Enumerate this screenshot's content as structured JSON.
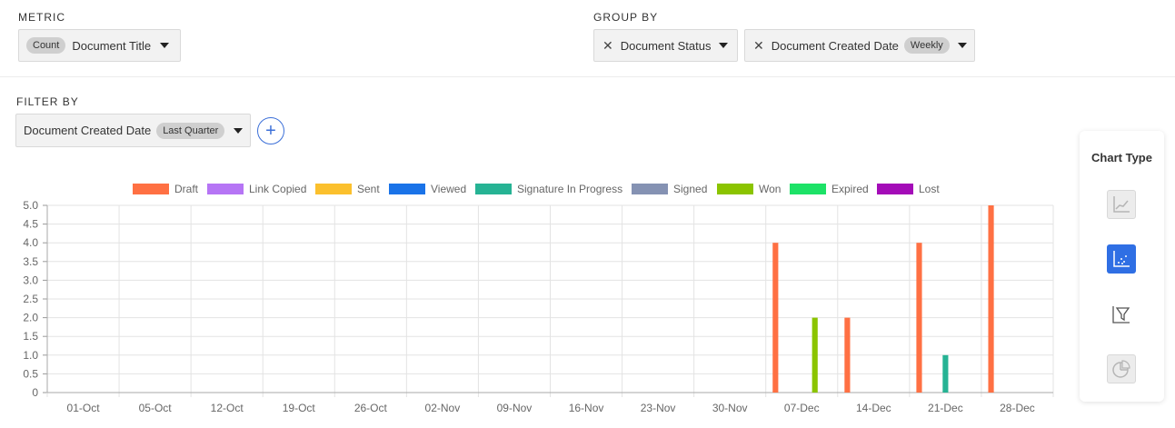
{
  "metric": {
    "label": "METRIC",
    "aggregation": "Count",
    "field": "Document Title"
  },
  "group_by": {
    "label": "GROUP BY",
    "fields": [
      {
        "name": "Document Status"
      },
      {
        "name": "Document Created Date",
        "interval": "Weekly"
      }
    ]
  },
  "filter_by": {
    "label": "FILTER BY",
    "field": "Document Created Date",
    "value": "Last Quarter"
  },
  "chart_type_panel": {
    "title": "Chart Type",
    "options": [
      "line-chart-icon",
      "bar-chart-icon",
      "funnel-chart-icon",
      "pie-chart-icon"
    ],
    "selected": "bar-chart-icon"
  },
  "chart_data": {
    "type": "bar",
    "categories": [
      "01-Oct",
      "05-Oct",
      "12-Oct",
      "19-Oct",
      "26-Oct",
      "02-Nov",
      "09-Nov",
      "16-Nov",
      "23-Nov",
      "30-Nov",
      "07-Dec",
      "14-Dec",
      "21-Dec",
      "28-Dec"
    ],
    "ylim": [
      0,
      5
    ],
    "yticks": [
      "0",
      "0.5",
      "1.0",
      "1.5",
      "2.0",
      "2.5",
      "3.0",
      "3.5",
      "4.0",
      "4.5",
      "5.0"
    ],
    "grid": true,
    "legend_position": "top",
    "series": [
      {
        "name": "Draft",
        "color": "#ff7043",
        "values": [
          0,
          0,
          0,
          0,
          0,
          0,
          0,
          0,
          0,
          0,
          4,
          2,
          4,
          5
        ]
      },
      {
        "name": "Link Copied",
        "color": "#b675f5",
        "values": [
          0,
          0,
          0,
          0,
          0,
          0,
          0,
          0,
          0,
          0,
          0,
          0,
          0,
          0
        ]
      },
      {
        "name": "Sent",
        "color": "#fbc02d",
        "values": [
          0,
          0,
          0,
          0,
          0,
          0,
          0,
          0,
          0,
          0,
          0,
          0,
          0,
          0
        ]
      },
      {
        "name": "Viewed",
        "color": "#1a73e8",
        "values": [
          0,
          0,
          0,
          0,
          0,
          0,
          0,
          0,
          0,
          0,
          0,
          0,
          0,
          0
        ]
      },
      {
        "name": "Signature In Progress",
        "color": "#26b394",
        "values": [
          0,
          0,
          0,
          0,
          0,
          0,
          0,
          0,
          0,
          0,
          0,
          0,
          1,
          0
        ]
      },
      {
        "name": "Signed",
        "color": "#8592b3",
        "values": [
          0,
          0,
          0,
          0,
          0,
          0,
          0,
          0,
          0,
          0,
          0,
          0,
          0,
          0
        ]
      },
      {
        "name": "Won",
        "color": "#8bc400",
        "values": [
          0,
          0,
          0,
          0,
          0,
          0,
          0,
          0,
          0,
          0,
          2,
          0,
          0,
          0
        ]
      },
      {
        "name": "Expired",
        "color": "#1de267",
        "values": [
          0,
          0,
          0,
          0,
          0,
          0,
          0,
          0,
          0,
          0,
          0,
          0,
          0,
          0
        ]
      },
      {
        "name": "Lost",
        "color": "#a40cb8",
        "values": [
          0,
          0,
          0,
          0,
          0,
          0,
          0,
          0,
          0,
          0,
          0,
          0,
          0,
          0
        ]
      }
    ]
  }
}
